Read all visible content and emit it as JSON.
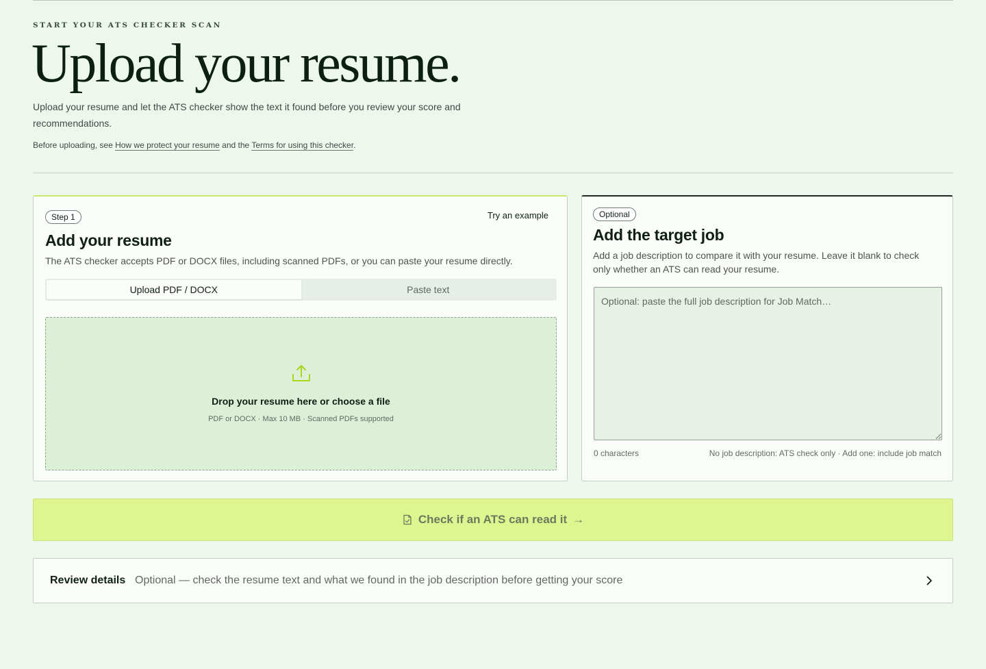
{
  "header": {
    "eyebrow": "START YOUR ATS CHECKER SCAN",
    "title": "Upload your resume.",
    "subtitle": "Upload your resume and let the ATS checker show the text it found before you review your score and recommendations.",
    "note_prefix": "Before uploading, see ",
    "link_privacy": "How we protect your resume",
    "note_middle": " and the ",
    "link_terms": "Terms for using this checker",
    "note_suffix": "."
  },
  "resume_card": {
    "step_badge": "Step 1",
    "try_example": "Try an example",
    "title": "Add your resume",
    "description": "The ATS checker accepts PDF or DOCX files, including scanned PDFs, or you can paste your resume directly.",
    "tabs": [
      {
        "label": "Upload PDF / DOCX",
        "active": true
      },
      {
        "label": "Paste text",
        "active": false
      }
    ],
    "dropzone": {
      "icon": "upload-icon",
      "title": "Drop your resume here or choose a file",
      "meta": "PDF or DOCX · Max 10 MB · Scanned PDFs supported"
    }
  },
  "job_card": {
    "badge": "Optional",
    "title": "Add the target job",
    "description": "Add a job description to compare it with your resume. Leave it blank to check only whether an ATS can read your resume.",
    "textarea_placeholder": "Optional: paste the full job description for Job Match…",
    "textarea_value": "",
    "char_count": "0 characters",
    "hint": "No job description: ATS check only · Add one: include job match"
  },
  "cta": {
    "icon": "document-icon",
    "label": "Check if an ATS can read it",
    "arrow": "→"
  },
  "review": {
    "title": "Review details",
    "description": "Optional — check the resume text and what we found in the job description before getting your score",
    "icon": "chevron-right-icon"
  },
  "colors": {
    "background": "#eef7ee",
    "accent": "#dff590",
    "dropzone": "#dcf0d8"
  }
}
